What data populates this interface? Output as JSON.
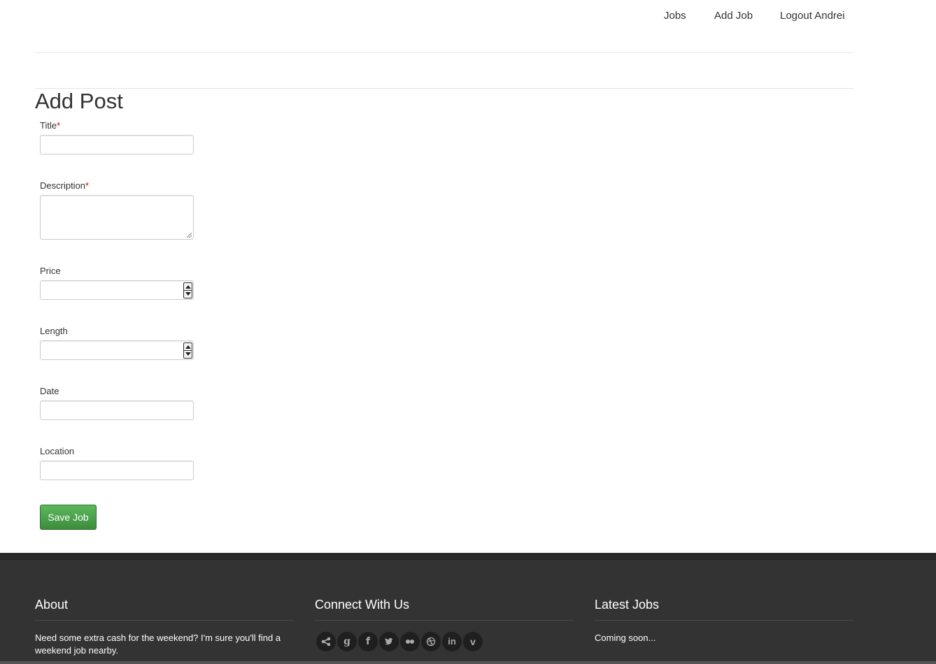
{
  "nav": {
    "items": [
      {
        "label": "Jobs"
      },
      {
        "label": "Add Job"
      },
      {
        "label": "Logout Andrei"
      }
    ]
  },
  "page": {
    "title": "Add Post"
  },
  "form": {
    "title": {
      "label": "Title",
      "required": "*",
      "value": ""
    },
    "description": {
      "label": "Description",
      "required": "*",
      "value": ""
    },
    "price": {
      "label": "Price",
      "value": ""
    },
    "length": {
      "label": "Length",
      "value": ""
    },
    "date": {
      "label": "Date",
      "value": ""
    },
    "location": {
      "label": "Location",
      "value": ""
    },
    "save_label": "Save Job"
  },
  "footer": {
    "about": {
      "heading": "About",
      "text": "Need some extra cash for the weekend? I'm sure you'll find a weekend job nearby."
    },
    "connect": {
      "heading": "Connect With Us",
      "icons": [
        "share-icon",
        "google-icon",
        "facebook-icon",
        "twitter-icon",
        "flickr-icon",
        "dribbble-icon",
        "linkedin-icon",
        "vimeo-icon"
      ]
    },
    "latest": {
      "heading": "Latest Jobs",
      "text": "Coming soon..."
    }
  },
  "colors": {
    "button_green": "#5cb85c",
    "footer_bg": "#333333",
    "required": "#cc0000"
  }
}
